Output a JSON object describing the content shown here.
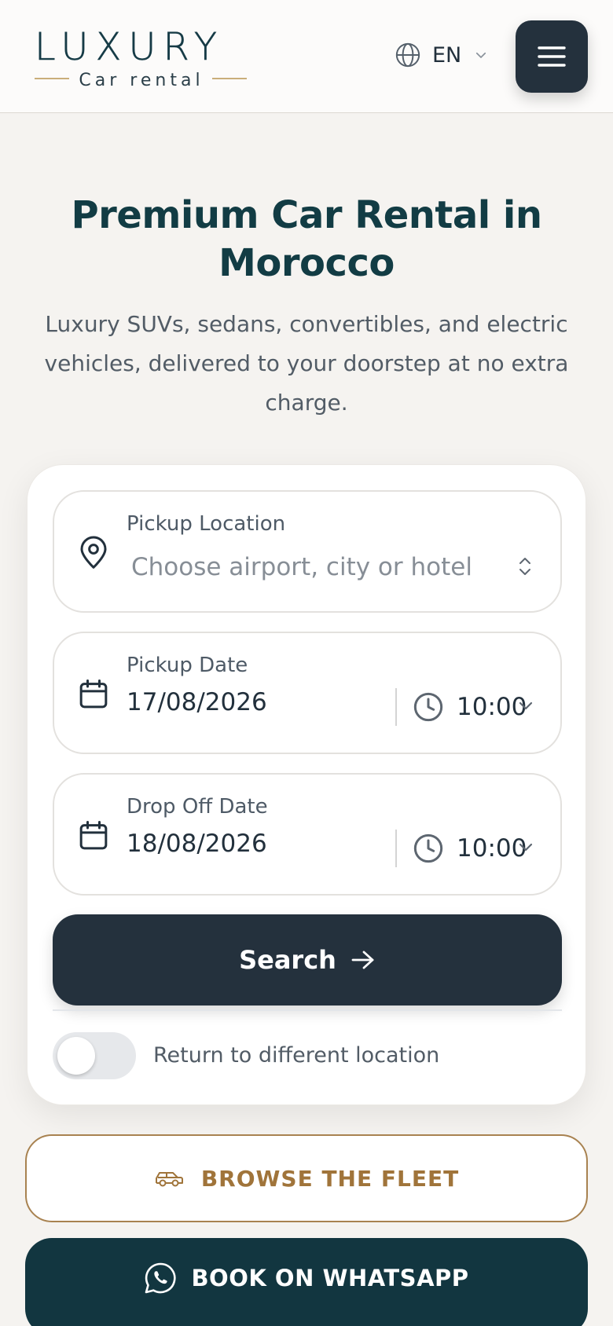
{
  "header": {
    "logo_main": "LUXURY",
    "logo_sub": "Car rental",
    "language": "EN",
    "icons": {
      "language": "globe-icon",
      "language_dropdown": "chevron-down-icon",
      "menu": "hamburger-menu-icon"
    }
  },
  "hero": {
    "title": "Premium Car Rental in Morocco",
    "subtitle": "Luxury SUVs, sedans, convertibles, and electric vehicles, delivered to your doorstep at no extra charge."
  },
  "booking": {
    "pickup_location": {
      "label": "Pickup Location",
      "placeholder": "Choose airport, city or hotel",
      "icon": "map-pin-icon"
    },
    "pickup_date": {
      "label": "Pickup Date",
      "date": "17/08/2026",
      "time": "10:00",
      "icon": "calendar-icon"
    },
    "dropoff_date": {
      "label": "Drop Off Date",
      "date": "18/08/2026",
      "time": "10:00",
      "icon": "calendar-icon"
    },
    "search_label": "Search",
    "return_toggle": {
      "label": "Return to different location",
      "enabled": false
    }
  },
  "actions": {
    "browse_label": "BROWSE THE FLEET",
    "whatsapp_label": "BOOK ON WHATSAPP"
  },
  "colors": {
    "primary_dark": "#24313d",
    "teal_dark": "#123c44",
    "gold": "#a88250",
    "background": "#f5f3f0"
  }
}
